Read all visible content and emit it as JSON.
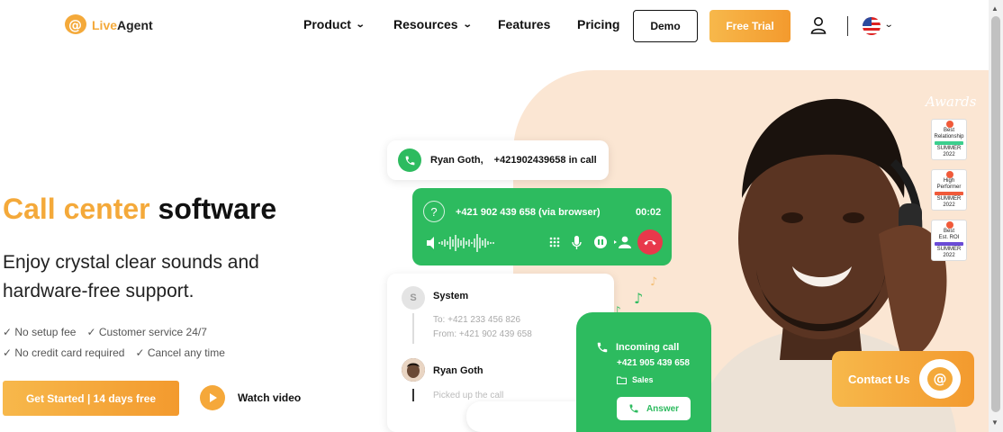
{
  "nav": {
    "logo_text_live": "Live",
    "logo_text_agent": "Agent",
    "product": "Product",
    "resources": "Resources",
    "features": "Features",
    "pricing": "Pricing",
    "demo": "Demo",
    "free_trial": "Free Trial"
  },
  "hero": {
    "title_accent": "Call center",
    "title_rest": "software",
    "subtitle": "Enjoy crystal clear sounds and hardware-free support.",
    "checks_row1": [
      "✓ No setup fee",
      "✓ Customer service 24/7"
    ],
    "checks_row2": [
      "✓ No credit card required",
      "✓ Cancel any time"
    ],
    "cta": "Get Started | 14 days free",
    "watch": "Watch video"
  },
  "call_card": {
    "name": "Ryan Goth,",
    "number": "+421902439658 in call"
  },
  "browser_call": {
    "question": "?",
    "number": "+421 902 439 658 (via browser)",
    "timer": "00:02"
  },
  "timeline": {
    "system_initial": "S",
    "system_name": "System",
    "to": "To: +421 233 456 826",
    "from": "From: +421 902 439 658",
    "agent_name": "Ryan Goth",
    "agent_status": "Picked up the call"
  },
  "incoming": {
    "title": "Incoming call",
    "number": "+421 905 439 658",
    "dept": "Sales",
    "answer": "Answer"
  },
  "awards": {
    "title": "Awards",
    "badges": [
      {
        "l1": "Best",
        "l2": "Relationship",
        "l3": "SUMMER",
        "l4": "2022",
        "ribbon": "#3ccf8e"
      },
      {
        "l1": "High",
        "l2": "Performer",
        "l3": "SUMMER",
        "l4": "2022",
        "ribbon": "#f05a3a"
      },
      {
        "l1": "Best",
        "l2": "Est. ROI",
        "l3": "SUMMER",
        "l4": "2022",
        "ribbon": "#6a4bd6"
      }
    ]
  },
  "contact": {
    "label": "Contact Us"
  },
  "colors": {
    "accent": "#f4a93a",
    "green": "#2dbb5f",
    "peach": "#fbe6d3",
    "hangup": "#e8384b"
  }
}
